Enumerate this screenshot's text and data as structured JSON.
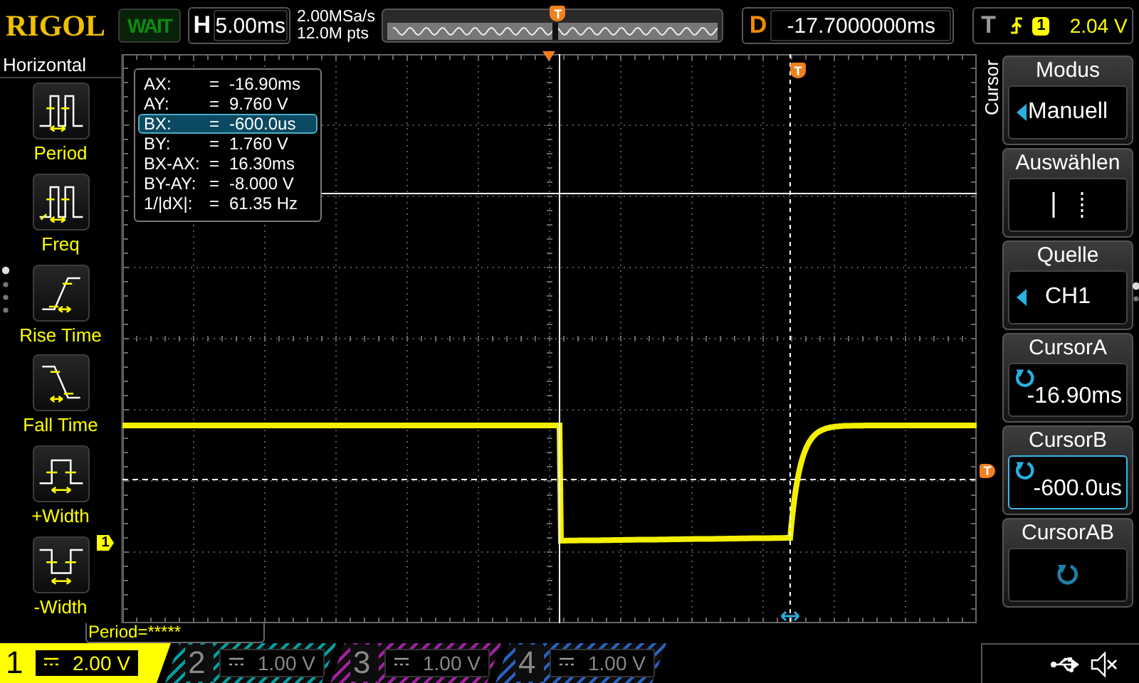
{
  "header": {
    "brand": "RIGOL",
    "run_status": "WAIT",
    "timebase": {
      "label": "H",
      "value": "5.00ms"
    },
    "sample_rate": "2.00MSa/s",
    "memory_depth": "12.0M pts",
    "overview_marker": "T",
    "delay": {
      "label": "D",
      "value": "-17.7000000ms"
    },
    "trigger": {
      "label": "T",
      "source": "1",
      "level": "2.04 V"
    }
  },
  "measure_menu": {
    "title": "Horizontal",
    "items": [
      {
        "kind": "period",
        "label": "Period"
      },
      {
        "kind": "freq",
        "label": "Freq"
      },
      {
        "kind": "rise",
        "label": "Rise Time"
      },
      {
        "kind": "fall",
        "label": "Fall Time"
      },
      {
        "kind": "pwidth",
        "label": "+Width"
      },
      {
        "kind": "nwidth",
        "label": "-Width"
      }
    ]
  },
  "cursor_readout": [
    {
      "name": "AX:",
      "sign": "=",
      "value": "-16.90ms",
      "selected": false
    },
    {
      "name": "AY:",
      "sign": "=",
      "value": "9.760 V",
      "selected": false
    },
    {
      "name": "BX:",
      "sign": "=",
      "value": "-600.0us",
      "selected": true
    },
    {
      "name": "BY:",
      "sign": "=",
      "value": "1.760 V",
      "selected": false
    },
    {
      "name": "BX-AX:",
      "sign": "=",
      "value": "16.30ms",
      "selected": false
    },
    {
      "name": "BY-AY:",
      "sign": "=",
      "value": "-8.000 V",
      "selected": false
    },
    {
      "name": "1/|dX|:",
      "sign": "=",
      "value": "61.35 Hz",
      "selected": false
    }
  ],
  "screen": {
    "trigger_position_marker": "T",
    "trigger_level_marker": "T",
    "channel_marker": "1"
  },
  "measurement_bar": "Period=*****",
  "channels": [
    {
      "number": "1",
      "scale": "2.00 V",
      "on": true,
      "color": "#ffff00"
    },
    {
      "number": "2",
      "scale": "1.00 V",
      "on": false,
      "color": "#00a0a0"
    },
    {
      "number": "3",
      "scale": "1.00 V",
      "on": false,
      "color": "#a020a0"
    },
    {
      "number": "4",
      "scale": "1.00 V",
      "on": false,
      "color": "#2a60c0"
    }
  ],
  "menu": {
    "title": "Cursor",
    "items": [
      {
        "kind": "option",
        "label": "Modus",
        "value": "Manuell",
        "selected": false
      },
      {
        "kind": "select",
        "label": "Auswählen",
        "selected": false
      },
      {
        "kind": "option",
        "label": "Quelle",
        "value": "CH1",
        "selected": false
      },
      {
        "kind": "knob",
        "label": "CursorA",
        "value": "-16.90ms",
        "selected": false
      },
      {
        "kind": "knob",
        "label": "CursorB",
        "value": "-600.0us",
        "selected": true
      },
      {
        "kind": "knob",
        "label": "CursorAB",
        "selected": false
      }
    ]
  }
}
